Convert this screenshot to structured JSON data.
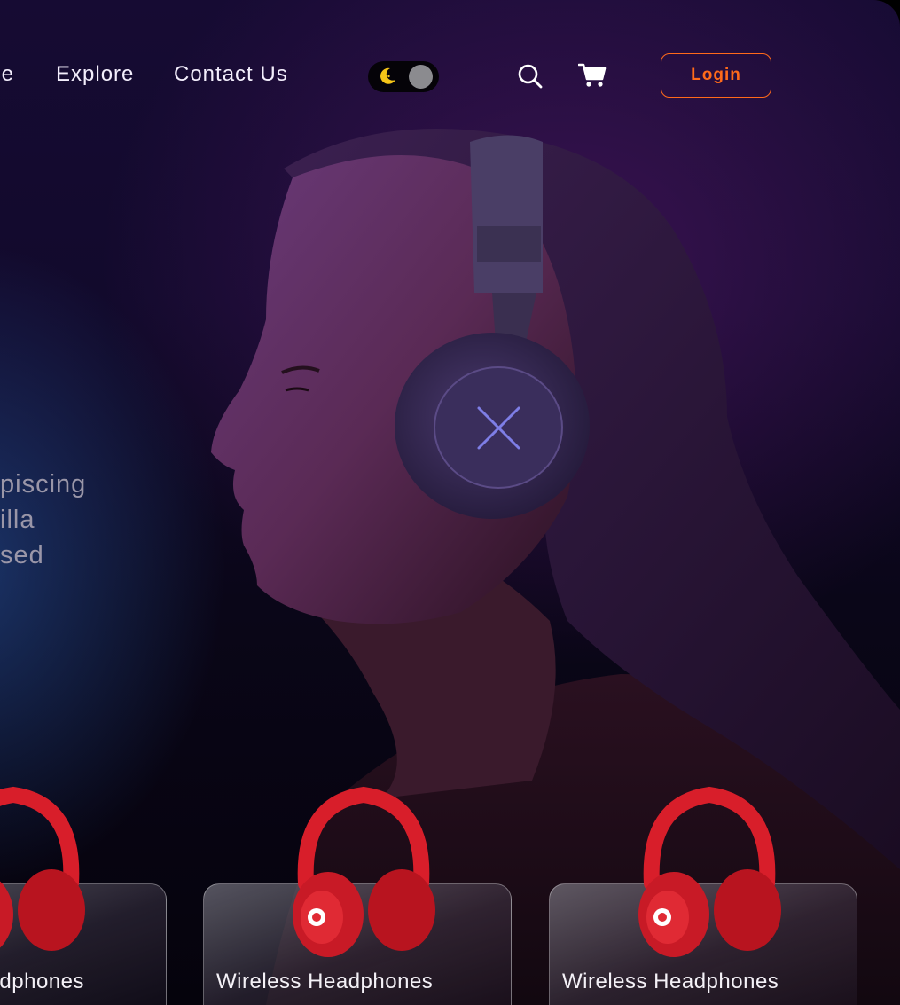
{
  "nav": {
    "home_fragment": "e",
    "explore": "Explore",
    "contact": "Contact Us",
    "login": "Login"
  },
  "theme_toggle": {
    "mode": "dark",
    "icon": "moon-icon"
  },
  "icons": {
    "search": "search-icon",
    "cart": "cart-icon"
  },
  "hero": {
    "description_lines": [
      "piscing",
      "illa",
      "sed"
    ]
  },
  "products": [
    {
      "title": "dphones",
      "image": "red-headphones"
    },
    {
      "title": "Wireless Headphones",
      "image": "red-headphones"
    },
    {
      "title": "Wireless Headphones",
      "image": "red-headphones"
    }
  ],
  "colors": {
    "accent": "#ff6a1a",
    "background": "#120a2c",
    "product": "#e0202a"
  }
}
